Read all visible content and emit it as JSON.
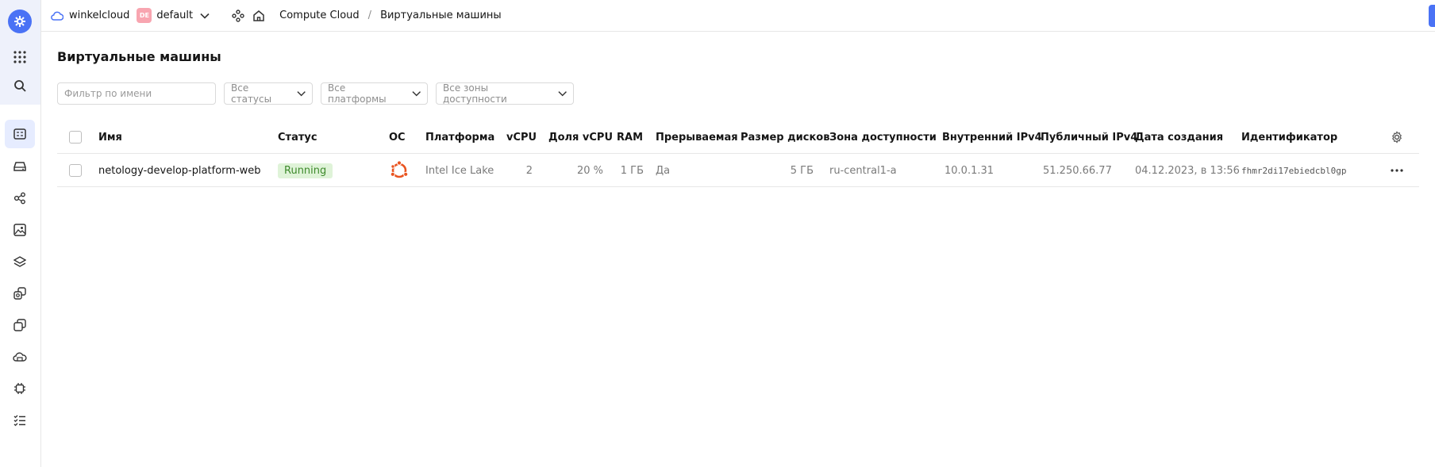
{
  "header": {
    "cloud_name": "winkelcloud",
    "folder_badge": "DE",
    "folder_name": "default",
    "breadcrumb": [
      "Compute Cloud",
      "Виртуальные машины"
    ],
    "separator": "/"
  },
  "sidebar": {
    "items": [
      "logo-icon",
      "services-grid-icon",
      "search-icon",
      "vm-list-icon",
      "disk-icon",
      "placement-icon",
      "image-icon",
      "layers-icon",
      "snapshots-icon",
      "instance-groups-icon",
      "gpu-cluster-icon",
      "chip-icon",
      "checklist-icon"
    ],
    "accent_color": "#4a72f5"
  },
  "page": {
    "title": "Виртуальные машины"
  },
  "filters": {
    "name_placeholder": "Фильтр по имени",
    "status_select": "Все статусы",
    "platform_select": "Все платформы",
    "zone_select": "Все зоны доступности"
  },
  "table": {
    "columns": {
      "name": "Имя",
      "status": "Статус",
      "os": "ОС",
      "platform": "Платформа",
      "vcpu": "vCPU",
      "vcpu_share": "Доля vCPU",
      "ram": "RAM",
      "preemptible": "Прерываемая",
      "disk_size": "Размер дисков",
      "zone": "Зона доступности",
      "internal_ip": "Внутренний IPv4",
      "public_ip": "Публичный IPv4",
      "created": "Дата создания",
      "id": "Идентификатор"
    },
    "rows": [
      {
        "name": "netology-develop-platform-web",
        "status": "Running",
        "os_icon": "ubuntu-icon",
        "platform": "Intel Ice Lake",
        "vcpu": "2",
        "vcpu_share": "20 %",
        "ram": "1 ГБ",
        "preemptible": "Да",
        "disk_size": "5 ГБ",
        "zone": "ru-central1-a",
        "internal_ip": "10.0.1.31",
        "public_ip": "51.250.66.77",
        "created": "04.12.2023, в 13:56",
        "id": "fhmr2di17ebiedcbl0gp"
      }
    ]
  },
  "colors": {
    "status_running_bg": "#dff3d8",
    "status_running_text": "#3e8a2c",
    "ubuntu": "#e95420"
  }
}
